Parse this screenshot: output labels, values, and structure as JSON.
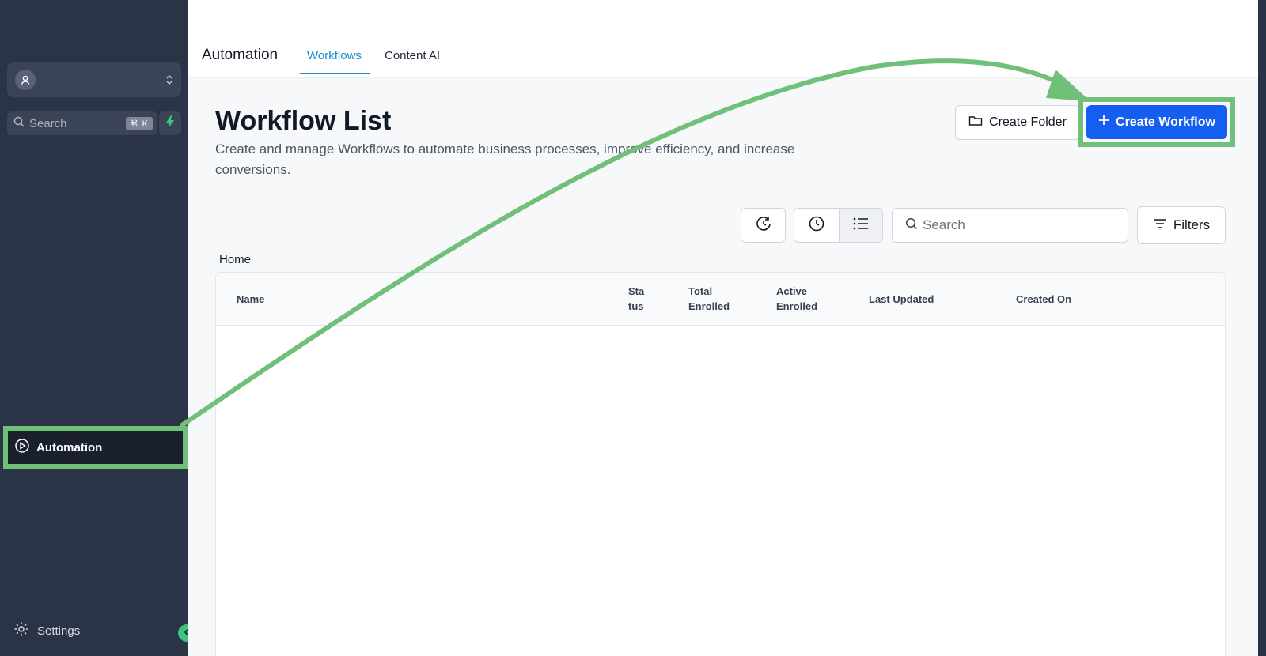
{
  "sidebar": {
    "search_placeholder": "Search",
    "search_shortcut": "⌘ K",
    "nav_active_label": "Automation",
    "settings_label": "Settings",
    "highlight_color": "#71c07a"
  },
  "topbar": {
    "app_title": "Automation",
    "tabs": [
      {
        "label": "Workflows",
        "active": true
      },
      {
        "label": "Content AI",
        "active": false
      }
    ]
  },
  "page": {
    "title": "Workflow List",
    "description": "Create and manage Workflows to automate business processes, improve efficiency, and increase conversions.",
    "create_folder_label": "Create Folder",
    "create_workflow_label": "Create Workflow",
    "accent_color": "#155eef"
  },
  "toolbar": {
    "search_placeholder": "Search",
    "filters_label": "Filters",
    "icons": [
      "history-icon",
      "clock-icon",
      "list-view-icon"
    ]
  },
  "breadcrumb": {
    "label": "Home"
  },
  "table": {
    "columns": [
      {
        "label": "Name"
      },
      {
        "label": "Sta tus"
      },
      {
        "label": "Total Enrolled"
      },
      {
        "label": "Active Enrolled"
      },
      {
        "label": "Last Updated"
      },
      {
        "label": "Created On"
      }
    ],
    "rows": []
  }
}
